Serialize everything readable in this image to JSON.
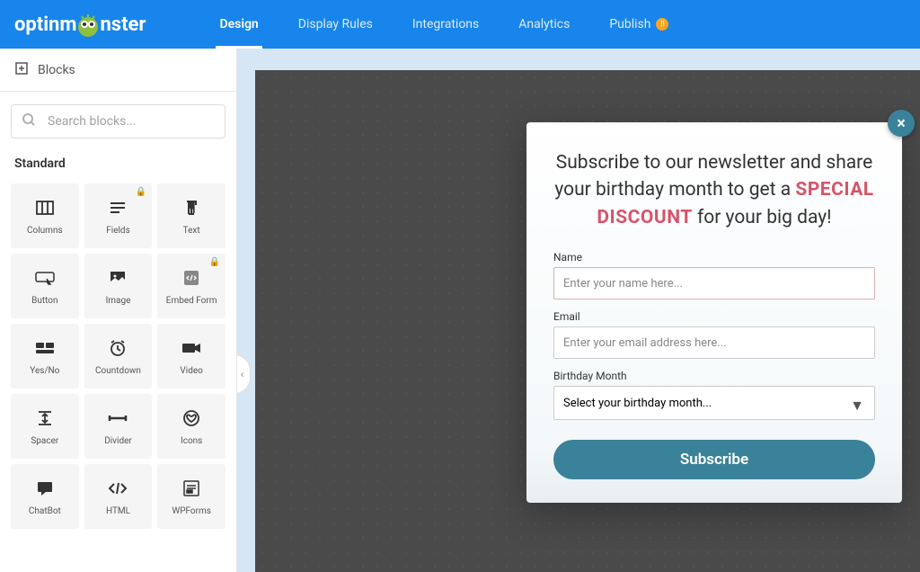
{
  "brand": "optinmonster",
  "nav": {
    "items": [
      {
        "label": "Design",
        "active": true
      },
      {
        "label": "Display Rules",
        "active": false
      },
      {
        "label": "Integrations",
        "active": false
      },
      {
        "label": "Analytics",
        "active": false
      },
      {
        "label": "Publish",
        "active": false,
        "badge": "!!"
      }
    ]
  },
  "sidebar": {
    "blocks_tab": "Blocks",
    "search_placeholder": "Search blocks...",
    "category": "Standard",
    "items": [
      {
        "label": "Columns",
        "icon": "columns",
        "locked": false
      },
      {
        "label": "Fields",
        "icon": "fields",
        "locked": true
      },
      {
        "label": "Text",
        "icon": "text",
        "locked": false
      },
      {
        "label": "Button",
        "icon": "button",
        "locked": false
      },
      {
        "label": "Image",
        "icon": "image",
        "locked": false
      },
      {
        "label": "Embed Form",
        "icon": "embed",
        "locked": true
      },
      {
        "label": "Yes/No",
        "icon": "yesno",
        "locked": false
      },
      {
        "label": "Countdown",
        "icon": "clock",
        "locked": false
      },
      {
        "label": "Video",
        "icon": "video",
        "locked": false
      },
      {
        "label": "Spacer",
        "icon": "spacer",
        "locked": false
      },
      {
        "label": "Divider",
        "icon": "divider",
        "locked": false
      },
      {
        "label": "Icons",
        "icon": "heart",
        "locked": false
      },
      {
        "label": "ChatBot",
        "icon": "chat",
        "locked": false
      },
      {
        "label": "HTML",
        "icon": "code",
        "locked": false
      },
      {
        "label": "WPForms",
        "icon": "form",
        "locked": false
      }
    ]
  },
  "popup": {
    "headline_pre": "Subscribe to our newsletter and share your birthday month to get a ",
    "headline_highlight": "SPECIAL DISCOUNT",
    "headline_post": " for your big day!",
    "name_label": "Name",
    "name_placeholder": "Enter your name here...",
    "email_label": "Email",
    "email_placeholder": "Enter your email address here...",
    "bmonth_label": "Birthday Month",
    "bmonth_placeholder": "Select your birthday month...",
    "submit": "Subscribe"
  }
}
